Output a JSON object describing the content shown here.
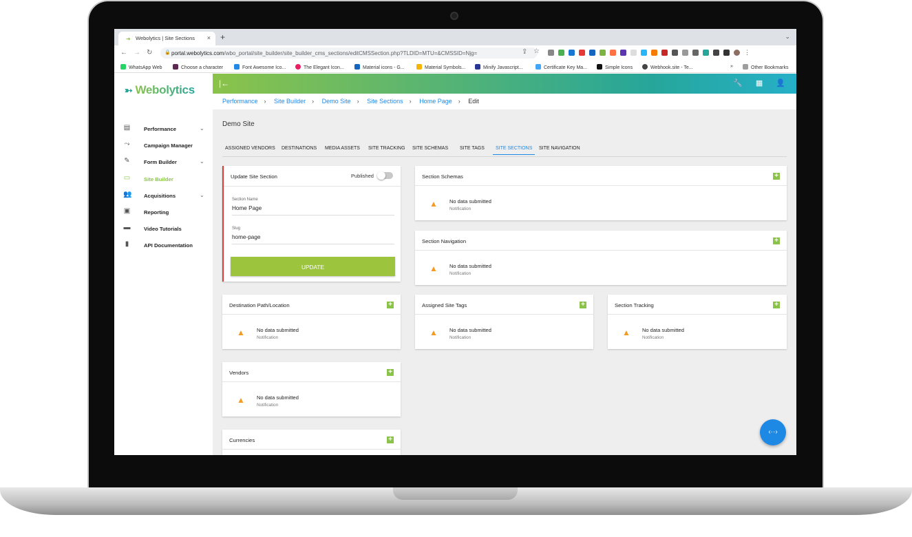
{
  "browser": {
    "tab_title": "Webolytics | Site Sections",
    "new_tab": "+",
    "url_domain": "portal.webolytics.com",
    "url_path": "/wbo_portal/site_builder/site_builder_cms_sections/editCMSSection.php?TLDID=MTU=&CMSSID=Njg=",
    "bookmarks": [
      "WhatsApp Web",
      "Choose a character",
      "Font Awesome Ico...",
      "The Elegant Icon...",
      "Material icons - G...",
      "Material Symbols...",
      "Minify Javascript...",
      "Certificate Key Ma...",
      "Simple Icons",
      "Webhook.site - Te..."
    ],
    "bookmarks_more": "»",
    "other_bookmarks": "Other Bookmarks"
  },
  "app": {
    "logo": "Webolytics",
    "sidebar": [
      {
        "label": "Performance",
        "icon": "dashboard-icon",
        "expand": true
      },
      {
        "label": "Campaign Manager",
        "icon": "trend-icon",
        "expand": false
      },
      {
        "label": "Form Builder",
        "icon": "form-icon",
        "expand": true
      },
      {
        "label": "Site Builder",
        "icon": "web-icon",
        "expand": false,
        "active": true
      },
      {
        "label": "Acquisitions",
        "icon": "people-icon",
        "expand": true
      },
      {
        "label": "Reporting",
        "icon": "report-icon",
        "expand": false
      },
      {
        "label": "Video Tutorials",
        "icon": "video-icon",
        "expand": false
      },
      {
        "label": "API Documentation",
        "icon": "book-icon",
        "expand": false
      }
    ],
    "breadcrumbs": [
      "Performance",
      "Site Builder",
      "Demo Site",
      "Site Sections",
      "Home Page"
    ],
    "breadcrumb_current": "Edit",
    "site_title": "Demo Site",
    "tabs": [
      "ASSIGNED VENDORS",
      "DESTINATIONS",
      "MEDIA ASSETS",
      "SITE TRACKING",
      "SITE SCHEMAS",
      "SITE TAGS",
      "SITE SECTIONS",
      "SITE NAVIGATION"
    ],
    "selected_tab": "SITE SECTIONS",
    "update_card": {
      "title": "Update Site Section",
      "published_label": "Published",
      "section_name_label": "Section Name",
      "section_name_value": "Home Page",
      "slug_label": "Slug",
      "slug_value": "home-page",
      "button": "UPDATE"
    },
    "empty_text": "No data submitted",
    "empty_sub": "Notification",
    "cards": {
      "section_schemas": "Section Schemas",
      "section_navigation": "Section Navigation",
      "destination": "Destination Path/Location",
      "assigned_tags": "Assigned Site Tags",
      "section_tracking": "Section Tracking",
      "vendors": "Vendors",
      "currencies": "Currencies"
    },
    "fab_icon": "‹··›"
  },
  "colors": {
    "brand_green": "#8bc34a",
    "brand_teal": "#26a69a",
    "link_blue": "#1e88e5",
    "warning": "#f59b23",
    "required": "#e53935"
  }
}
